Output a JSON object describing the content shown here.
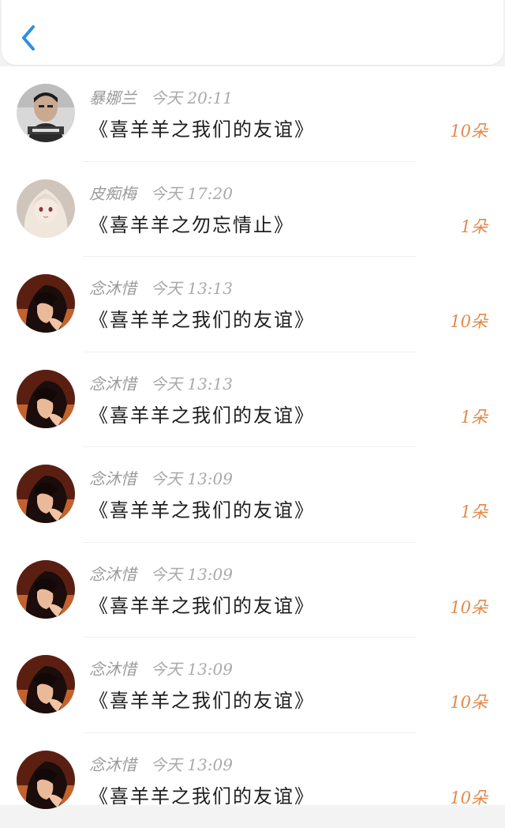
{
  "header": {
    "back_icon": "chevron-left-icon",
    "accent_color": "#2f8fe0"
  },
  "records": [
    {
      "name": "暴娜兰",
      "time": "今天 20:11",
      "title": "《喜羊羊之我们的友谊》",
      "count": "10朵",
      "avatar": "boy-photo-avatar"
    },
    {
      "name": "皮痴梅",
      "time": "今天 17:20",
      "title": "《喜羊羊之勿忘情止》",
      "count": "1朵",
      "avatar": "anime-girl-avatar"
    },
    {
      "name": "念沐惜",
      "time": "今天 13:13",
      "title": "《喜羊羊之我们的友谊》",
      "count": "10朵",
      "avatar": "anime-boy-avatar"
    },
    {
      "name": "念沐惜",
      "time": "今天 13:13",
      "title": "《喜羊羊之我们的友谊》",
      "count": "1朵",
      "avatar": "anime-boy-avatar"
    },
    {
      "name": "念沐惜",
      "time": "今天 13:09",
      "title": "《喜羊羊之我们的友谊》",
      "count": "1朵",
      "avatar": "anime-boy-avatar"
    },
    {
      "name": "念沐惜",
      "time": "今天 13:09",
      "title": "《喜羊羊之我们的友谊》",
      "count": "10朵",
      "avatar": "anime-boy-avatar"
    },
    {
      "name": "念沐惜",
      "time": "今天 13:09",
      "title": "《喜羊羊之我们的友谊》",
      "count": "10朵",
      "avatar": "anime-boy-avatar"
    },
    {
      "name": "念沐惜",
      "time": "今天 13:09",
      "title": "《喜羊羊之我们的友谊》",
      "count": "10朵",
      "avatar": "anime-boy-avatar"
    }
  ],
  "colors": {
    "count": "#e3894a",
    "meta": "#9a9a9a",
    "title": "#1e1e1e"
  }
}
